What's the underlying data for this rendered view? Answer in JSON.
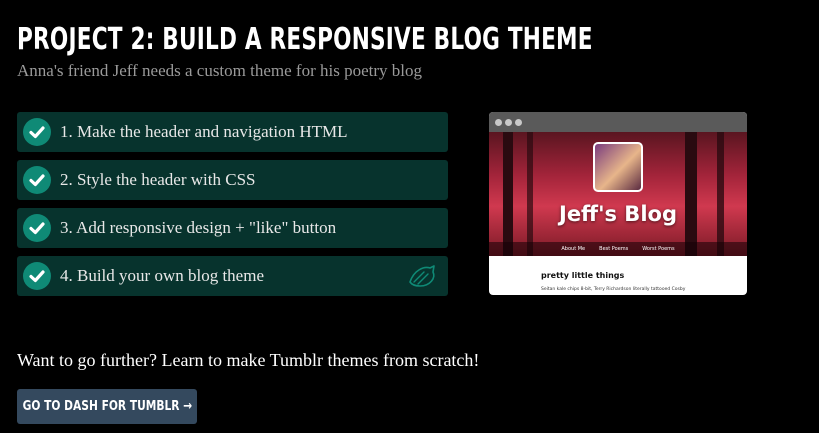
{
  "header": {
    "title": "Project 2: Build a Responsive Blog Theme",
    "subtitle": "Anna's friend Jeff needs a custom theme for his poetry blog"
  },
  "steps": [
    {
      "label": "1. Make the header and navigation HTML",
      "completed": true
    },
    {
      "label": "2. Style the header with CSS",
      "completed": true
    },
    {
      "label": "3. Add responsive design + \"like\" button",
      "completed": true
    },
    {
      "label": "4. Build your own blog theme",
      "completed": true,
      "extra_icon": "badge-icon"
    }
  ],
  "preview": {
    "blog_title": "Jeff's Blog",
    "nav": [
      "About Me",
      "Best Poems",
      "Worst Poems"
    ],
    "post_title": "pretty little things",
    "post_text": "Seitan kale chips 8-bit, Terry Richardson literally tattooed Cosby"
  },
  "footer": {
    "further_text": "Want to go further? Learn to make Tumblr themes from scratch!",
    "cta_label": "Go to Dash for Tumblr →"
  },
  "colors": {
    "step_bg": "#07332d",
    "check": "#0f8a76",
    "button": "#34495e",
    "background": "#000000"
  }
}
